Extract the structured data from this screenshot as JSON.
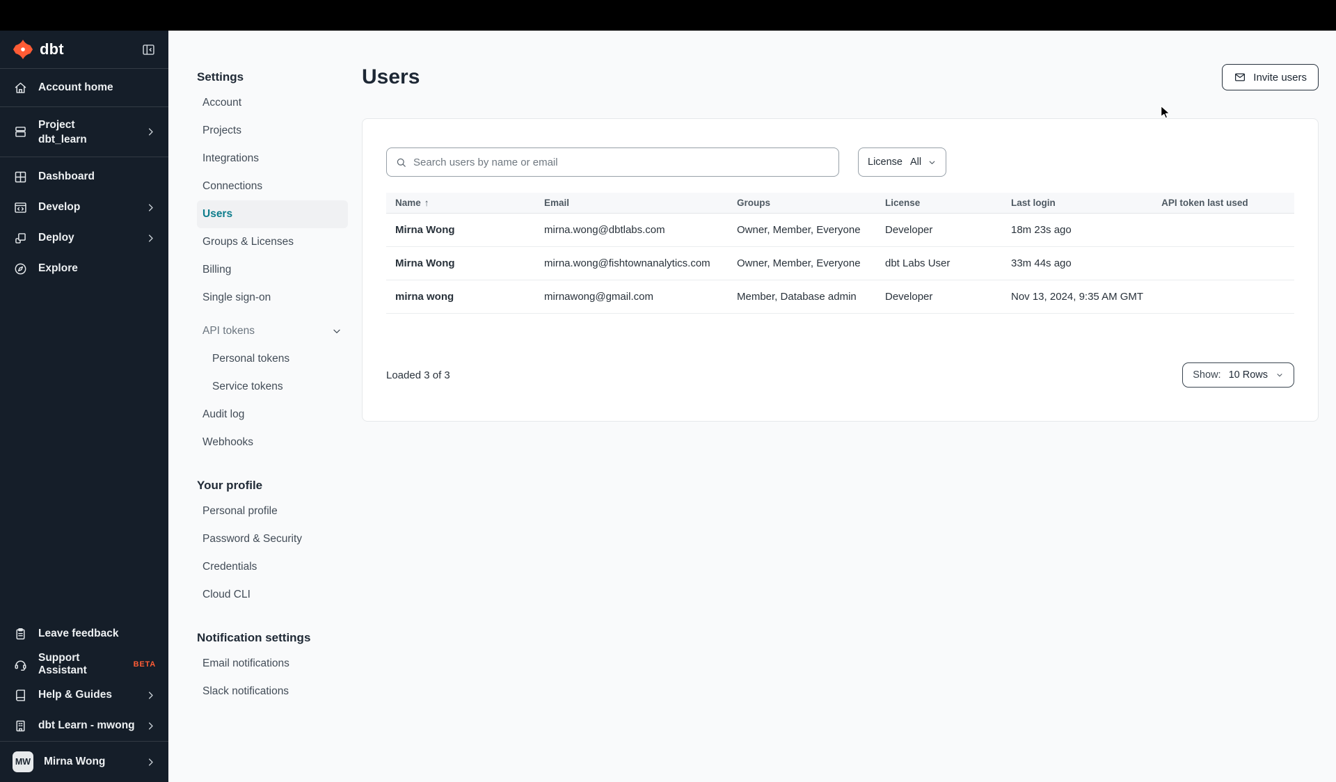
{
  "colors": {
    "topbar": "#000000",
    "sidebar_bg": "#151e29",
    "brand_orange": "#ff5c35",
    "selected_teal": "#0e7d8c",
    "page_bg": "#f9fafb",
    "card_bg": "#ffffff"
  },
  "sidebar": {
    "brand": "dbt",
    "account_home": "Account home",
    "project_label": "Project",
    "project_name": "dbt_learn",
    "dashboard": "Dashboard",
    "develop": "Develop",
    "deploy": "Deploy",
    "explore": "Explore",
    "leave_feedback": "Leave feedback",
    "support_assistant": "Support Assistant",
    "beta_badge": "BETA",
    "help_guides": "Help & Guides",
    "org_switcher": "dbt Learn - mwong",
    "user_name": "Mirna Wong",
    "user_initials": "MW"
  },
  "settings_nav": {
    "title": "Settings",
    "account": "Account",
    "projects": "Projects",
    "integrations": "Integrations",
    "connections": "Connections",
    "users": "Users",
    "groups_licenses": "Groups & Licenses",
    "billing": "Billing",
    "single_sign_on": "Single sign-on",
    "api_tokens": "API tokens",
    "personal_tokens": "Personal tokens",
    "service_tokens": "Service tokens",
    "audit_log": "Audit log",
    "webhooks": "Webhooks",
    "profile_title": "Your profile",
    "personal_profile": "Personal profile",
    "password_security": "Password & Security",
    "credentials": "Credentials",
    "cloud_cli": "Cloud CLI",
    "notifications_title": "Notification settings",
    "email_notifications": "Email notifications",
    "slack_notifications": "Slack notifications"
  },
  "main": {
    "title": "Users",
    "invite_button": "Invite users",
    "search_placeholder": "Search users by name or email",
    "license_filter": {
      "label": "License",
      "value": "All"
    },
    "table": {
      "sort_indicator": "↑",
      "columns": [
        "Name",
        "Email",
        "Groups",
        "License",
        "Last login",
        "API token last used"
      ],
      "rows": [
        {
          "name": "Mirna Wong",
          "email": "mirna.wong@dbtlabs.com",
          "groups": "Owner, Member, Everyone",
          "license": "Developer",
          "last_login": "18m 23s ago",
          "api_token_last_used": ""
        },
        {
          "name": "Mirna Wong",
          "email": "mirna.wong@fishtownanalytics.com",
          "groups": "Owner, Member, Everyone",
          "license": "dbt Labs User",
          "last_login": "33m 44s ago",
          "api_token_last_used": ""
        },
        {
          "name": "mirna wong",
          "email": "mirnawong@gmail.com",
          "groups": "Member, Database admin",
          "license": "Developer",
          "last_login": "Nov 13, 2024, 9:35 AM GMT",
          "api_token_last_used": ""
        }
      ]
    },
    "footer": {
      "loaded": "Loaded 3 of 3",
      "show_label": "Show:",
      "show_value": "10 Rows"
    }
  }
}
